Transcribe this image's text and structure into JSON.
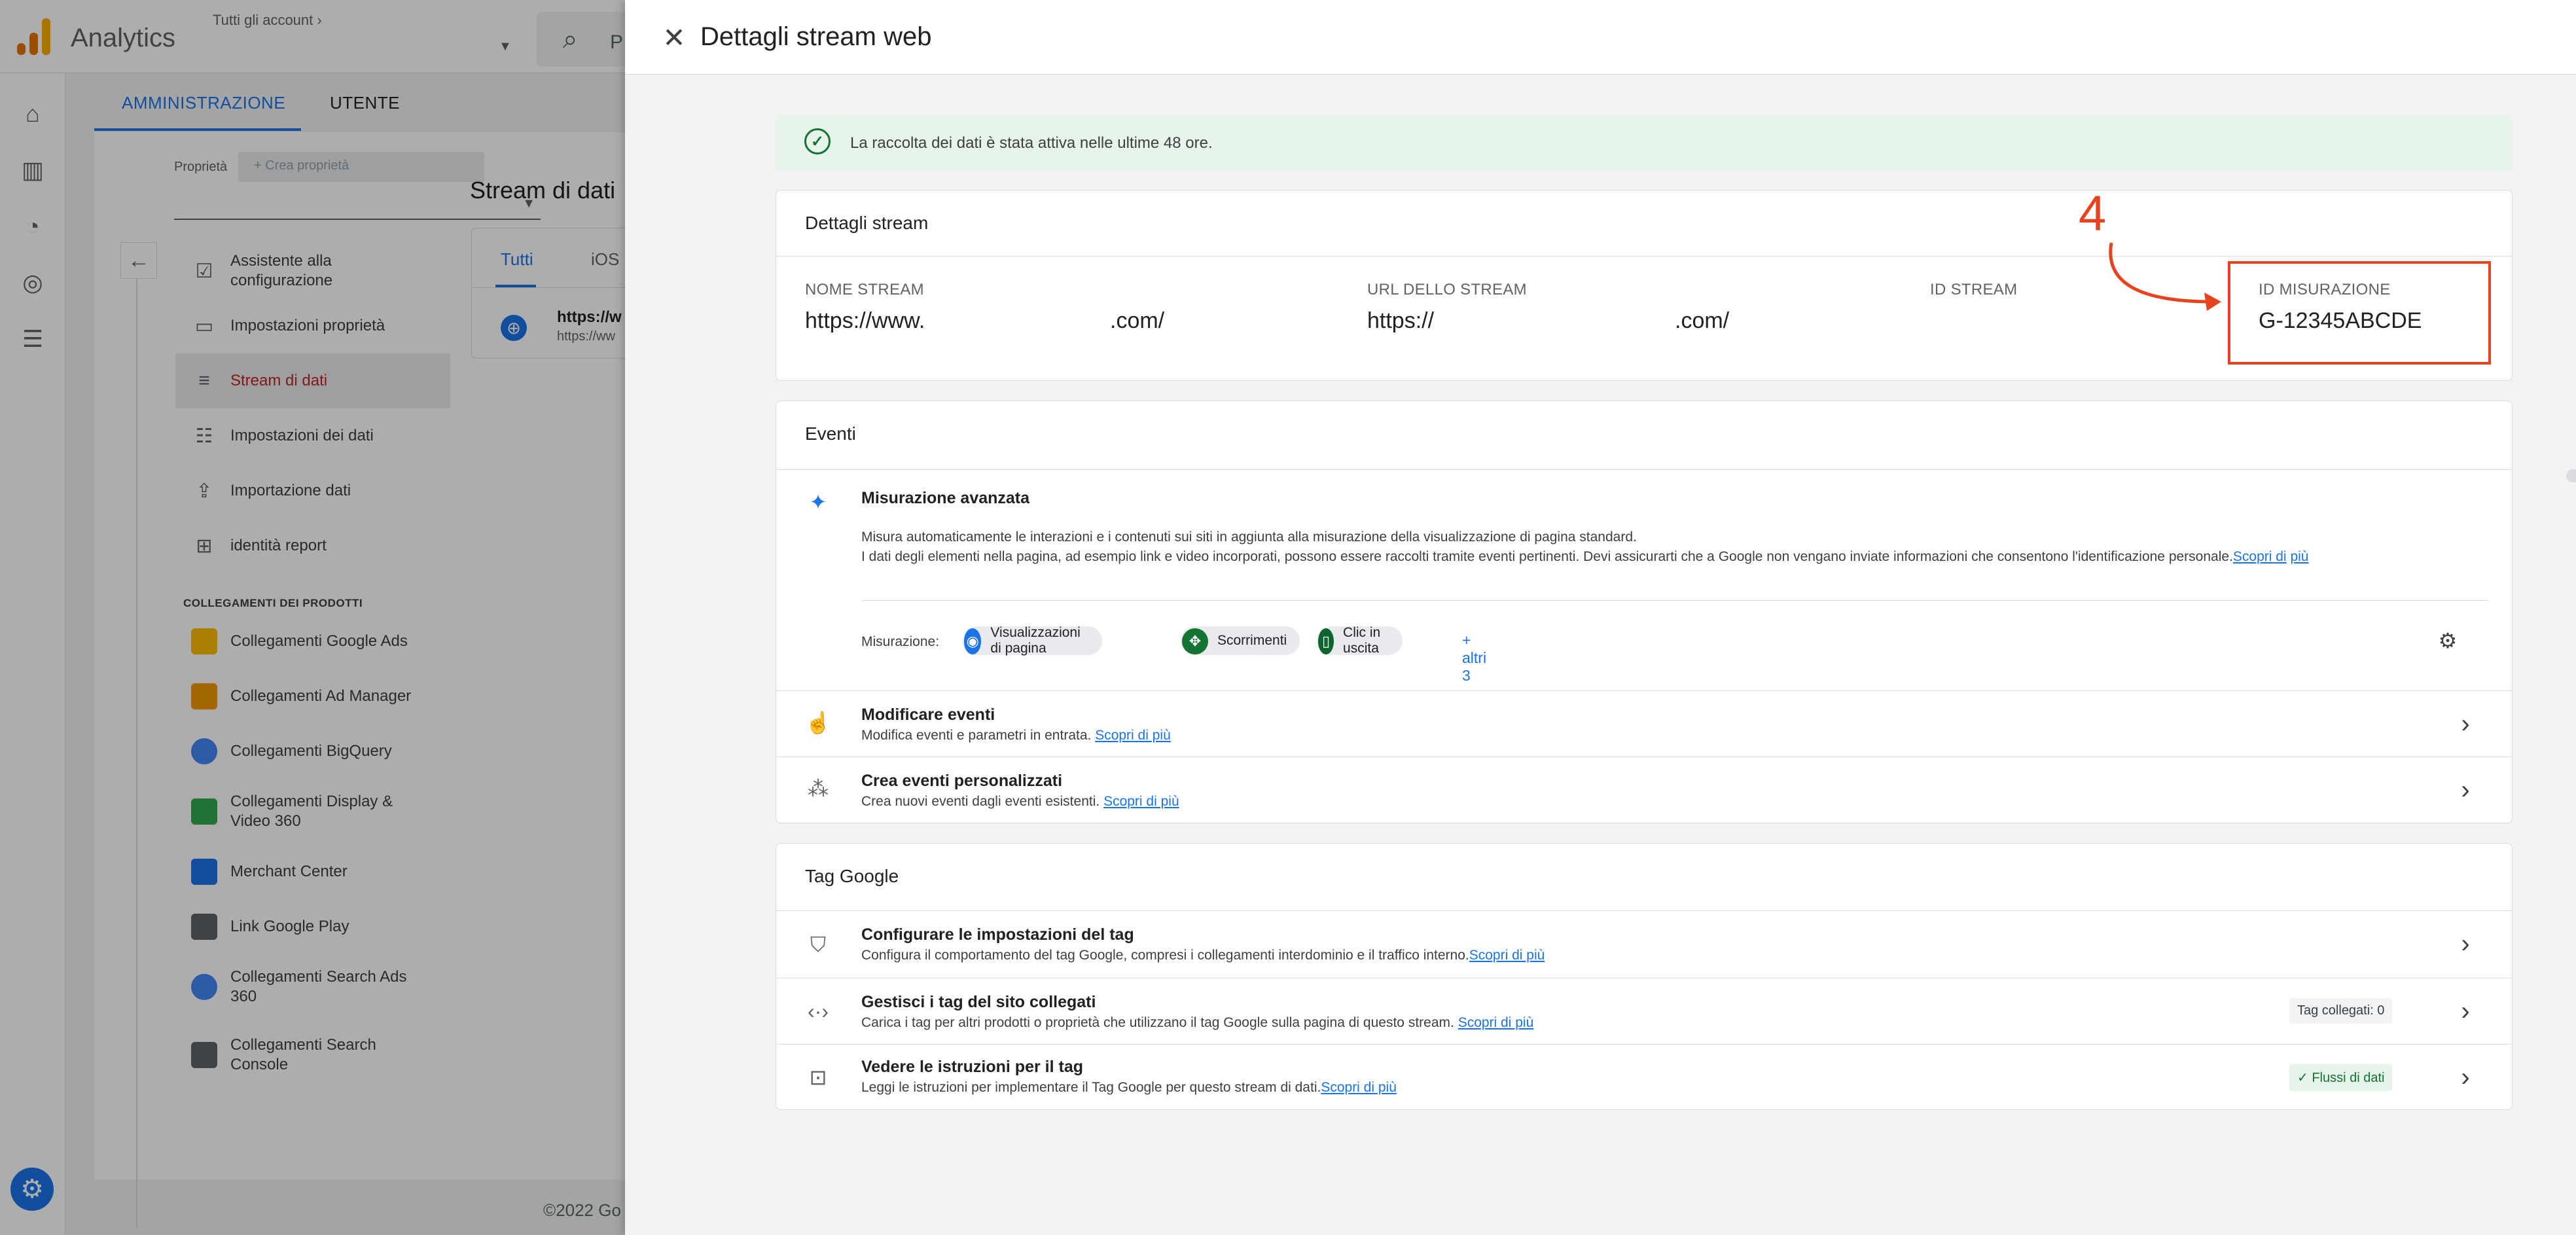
{
  "app": {
    "name": "Analytics",
    "account_breadcrumb": "Tutti gli account",
    "search_placeholder": "P",
    "logo_colors": [
      "#f9ab00",
      "#e37400",
      "#e37400"
    ]
  },
  "admin": {
    "tabs": [
      "AMMINISTRAZIONE",
      "UTENTE"
    ],
    "property_label": "Proprietà",
    "create_property": "Crea proprietà",
    "menu": [
      {
        "label": "Assistente alla configurazione",
        "icon": "checklist-icon"
      },
      {
        "label": "Impostazioni proprietà",
        "icon": "property-settings-icon"
      },
      {
        "label": "Stream di dati",
        "icon": "data-streams-icon"
      },
      {
        "label": "Impostazioni dei dati",
        "icon": "database-icon"
      },
      {
        "label": "Importazione dati",
        "icon": "upload-icon"
      },
      {
        "label": "identità report",
        "icon": "report-identity-icon"
      }
    ],
    "product_links_title": "COLLEGAMENTI DEI PRODOTTI",
    "product_links": [
      {
        "label": "Collegamenti Google Ads",
        "color": "#fbbc04"
      },
      {
        "label": "Collegamenti Ad Manager",
        "color": "#f29900"
      },
      {
        "label": "Collegamenti BigQuery",
        "color": "#4285f4"
      },
      {
        "label": "Collegamenti Display & Video 360",
        "color": "#34a853"
      },
      {
        "label": "Merchant Center",
        "color": "#1a73e8"
      },
      {
        "label": "Link Google Play",
        "color": "#5f6368"
      },
      {
        "label": "Collegamenti Search Ads 360",
        "color": "#4285f4"
      },
      {
        "label": "Collegamenti Search Console",
        "color": "#5f6368"
      }
    ],
    "streams_title": "Stream di dati",
    "stream_tabs": [
      "Tutti",
      "iOS"
    ],
    "stream_url": "https://w",
    "stream_url_sub": "https://ww",
    "copyright": "©2022 Go"
  },
  "drawer": {
    "title": "Dettagli stream web",
    "alert_text": "La raccolta dei dati è stata attiva nelle ultime 48 ore.",
    "stream_details": {
      "title": "Dettagli stream",
      "name_label": "NOME STREAM",
      "name_value_a": "https://www.",
      "name_value_b": ".com/",
      "url_label": "URL DELLO STREAM",
      "url_value_a": "https://",
      "url_value_b": ".com/",
      "id_label": "ID STREAM",
      "measurement_label": "ID MISURAZIONE",
      "measurement_value": "G-12345ABCDE",
      "annotation_number": "4",
      "annotation_color": "#e8431e"
    },
    "events": {
      "title": "Eventi",
      "enhanced_title": "Misurazione avanzata",
      "enhanced_desc1": "Misura automaticamente le interazioni e i contenuti sui siti in aggiunta alla misurazione della visualizzazione di pagina standard.",
      "enhanced_desc2": "I dati degli elementi nella pagina, ad esempio link e video incorporati, possono essere raccolti tramite eventi pertinenti. Devi assicurarti che a Google non vengano inviate informazioni che consentono l'identificazione personale.",
      "learn_more_split_a": "Scopri di",
      "learn_more_split_b": "più",
      "measurement_label": "Misurazione:",
      "chips": [
        {
          "label": "Visualizzazioni di pagina",
          "icon": "eye-icon",
          "color": "#1a73e8"
        },
        {
          "label": "Scorrimenti",
          "icon": "scroll-icon",
          "color": "#137333"
        },
        {
          "label": "Clic in uscita",
          "icon": "mouse-icon",
          "color": "#0d652d"
        }
      ],
      "more": "+ altri 3",
      "modify_title": "Modificare eventi",
      "modify_desc": "Modifica eventi e parametri in entrata.",
      "create_title": "Crea eventi personalizzati",
      "create_desc": "Crea nuovi eventi dagli eventi esistenti.",
      "learn_more": "Scopri di più"
    },
    "tag": {
      "title": "Tag Google",
      "configure_title": "Configurare le impostazioni del tag",
      "configure_desc": "Configura il comportamento del tag Google, compresi i collegamenti interdominio e il traffico interno.",
      "manage_title": "Gestisci i tag del sito collegati",
      "manage_desc": "Carica i tag per altri prodotti o proprietà che utilizzano il tag Google sulla pagina di questo stream.",
      "manage_badge": "Tag collegati: 0",
      "instructions_title": "Vedere le istruzioni per il tag",
      "instructions_desc": "Leggi le istruzioni per implementare il Tag Google per questo stream di dati.",
      "instructions_badge": "Flussi di dati",
      "learn_more": "Scopri di più"
    }
  }
}
